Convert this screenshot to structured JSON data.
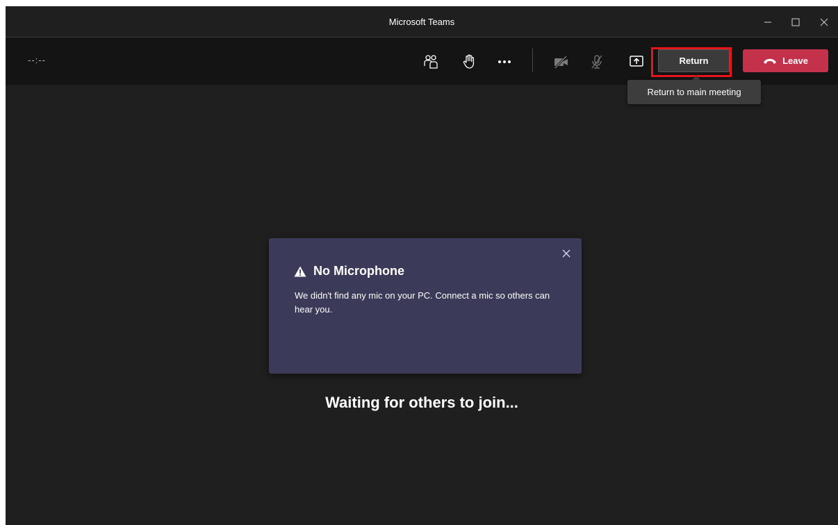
{
  "window": {
    "title": "Microsoft Teams"
  },
  "toolbar": {
    "timer": "--:--",
    "icons": [
      "participants-icon",
      "raise-hand-icon",
      "more-options-icon",
      "camera-off-icon",
      "mic-off-icon",
      "share-screen-icon"
    ],
    "return_label": "Return",
    "leave_label": "Leave",
    "return_tooltip": "Return to main meeting"
  },
  "notice": {
    "title": "No Microphone",
    "body": "We didn't find any mic on your PC. Connect a mic so others can hear you."
  },
  "stage": {
    "status": "Waiting for others to join..."
  },
  "colors": {
    "background": "#1f1f1f",
    "toolbar": "#141414",
    "leave": "#c4314b",
    "notice": "#3b3a58",
    "highlight": "#e8121b"
  }
}
